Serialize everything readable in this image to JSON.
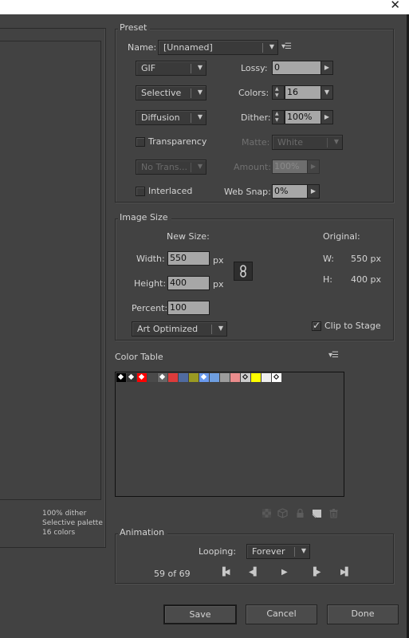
{
  "window": {
    "close_icon": "✕"
  },
  "preview": {
    "info_lines": [
      "100% dither",
      "Selective palette",
      "16 colors"
    ]
  },
  "preset": {
    "title": "Preset",
    "name_label": "Name:",
    "name_value": "[Unnamed]",
    "format": "GIF",
    "palette": "Selective",
    "dither_type": "Diffusion",
    "lossy_label": "Lossy:",
    "lossy_value": "0",
    "colors_label": "Colors:",
    "colors_value": "16",
    "dither_label": "Dither:",
    "dither_value": "100%",
    "transparency_label": "Transparency",
    "transparency_checked": false,
    "matte_label": "Matte:",
    "matte_value": "White",
    "transparency_dither": "No Trans...",
    "amount_label": "Amount:",
    "amount_value": "100%",
    "interlaced_label": "Interlaced",
    "interlaced_checked": false,
    "websnap_label": "Web Snap:",
    "websnap_value": "0%"
  },
  "image_size": {
    "title": "Image Size",
    "new_size_label": "New Size:",
    "width_label": "Width:",
    "width_value": "550",
    "height_label": "Height:",
    "height_value": "400",
    "unit": "px",
    "percent_label": "Percent:",
    "percent_value": "100",
    "quality": "Art Optimized",
    "original_label": "Original:",
    "orig_w_label": "W:",
    "orig_w_value": "550 px",
    "orig_h_label": "H:",
    "orig_h_value": "400 px",
    "clip_label": "Clip to Stage",
    "clip_checked": true
  },
  "color_table": {
    "title": "Color Table",
    "swatches": [
      {
        "color": "#000000",
        "marker": "#ffffff"
      },
      {
        "color": "#333333",
        "marker": "#ffffff"
      },
      {
        "color": "#ff0000",
        "marker": "#ffffff"
      },
      {
        "color": "#4a4a4a",
        "marker": null
      },
      {
        "color": "#666666",
        "marker": "#ffffff"
      },
      {
        "color": "#dd3b3b",
        "marker": null
      },
      {
        "color": "#506ba0",
        "marker": null
      },
      {
        "color": "#9a9a22",
        "marker": null
      },
      {
        "color": "#6a9aee",
        "marker": "#ffffff"
      },
      {
        "color": "#6e9ee0",
        "marker": null
      },
      {
        "color": "#9c9c9c",
        "marker": null
      },
      {
        "color": "#ea8c8c",
        "marker": null
      },
      {
        "color": "#cccccc",
        "marker": "#000000"
      },
      {
        "color": "#ffff00",
        "marker": null
      },
      {
        "color": "#eeeeee",
        "marker": null
      },
      {
        "color": "#ffffff",
        "marker": "#000000"
      }
    ],
    "tool_icons": [
      "transparent-color-icon",
      "web-snap-icon",
      "lock-color-icon",
      "new-color-icon",
      "delete-color-icon"
    ]
  },
  "animation": {
    "title": "Animation",
    "looping_label": "Looping:",
    "looping_value": "Forever",
    "frame_counter": "59 of 69",
    "controls": {
      "first": "▐◀",
      "prev": "◀▌",
      "play": "▶",
      "next": "▐▶",
      "last": "▶▌"
    }
  },
  "buttons": {
    "save": "Save",
    "cancel": "Cancel",
    "done": "Done"
  }
}
